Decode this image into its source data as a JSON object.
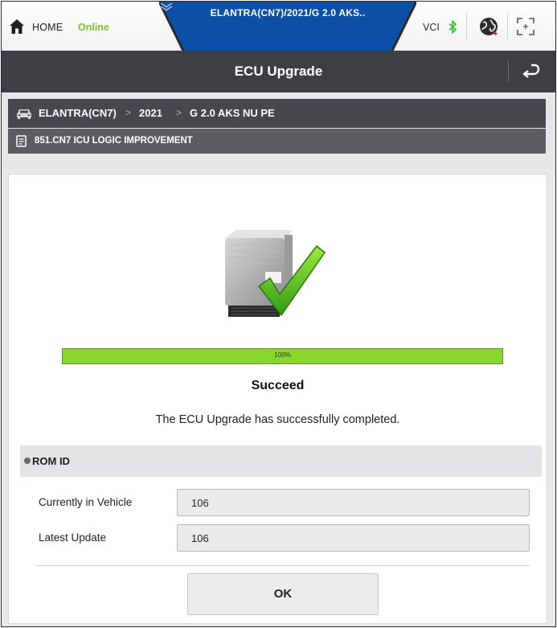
{
  "top_bar": {
    "home_label": "HOME",
    "online_label": "Online",
    "vehicle_title": "ELANTRA(CN7)/2021/G 2.0 AKS..",
    "vci_label": "VCI",
    "icons": [
      "home-icon",
      "chevron-down-icon",
      "bluetooth-icon",
      "globe-icon",
      "expand-icon"
    ]
  },
  "title_bar": {
    "title": "ECU Upgrade",
    "icons": [
      "back-icon"
    ]
  },
  "breadcrumb": {
    "items": [
      "ELANTRA(CN7)",
      "2021",
      "G 2.0 AKS NU PE"
    ],
    "subject": "851.CN7 ICU LOGIC IMPROVEMENT",
    "icons": [
      "car-icon",
      "document-icon"
    ]
  },
  "result": {
    "progress_percent": 100,
    "progress_label": "100%",
    "status_title": "Succeed",
    "status_message": "The ECU Upgrade has successfully completed."
  },
  "rom_id": {
    "header": "ROM ID",
    "rows": [
      {
        "label": "Currently in Vehicle",
        "value": "106"
      },
      {
        "label": "Latest Update",
        "value": "106"
      }
    ]
  },
  "actions": {
    "ok_label": "OK"
  },
  "colors": {
    "accent_blue": "#0b4fa7",
    "online_green": "#7ec226",
    "progress_green": "#8ad62a",
    "dark_bar": "#3e3f44"
  }
}
